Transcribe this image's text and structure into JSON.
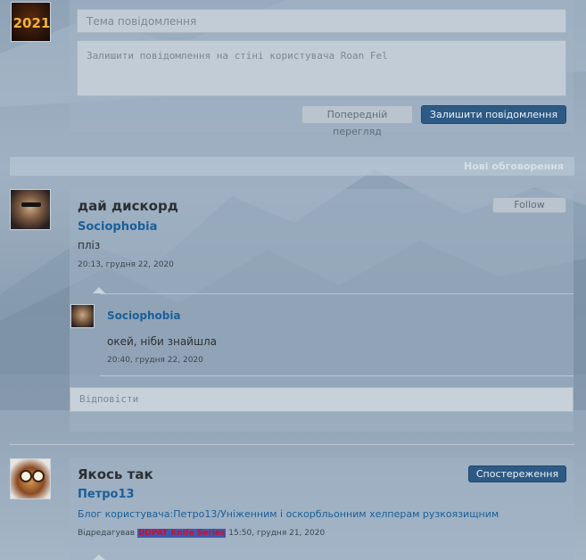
{
  "composer": {
    "subject_placeholder": "Тема повідомлення",
    "message_placeholder": "Залишити повідомлення на стіні користувача Roan Fel",
    "preview_label": "Попередній перегляд",
    "submit_label": "Залишити повідомлення",
    "avatar_caption": "2021"
  },
  "section": {
    "title": "Нові обговорення"
  },
  "thread1": {
    "title": "дай дискорд",
    "follow_label": "Follow",
    "author": "Sociophobia",
    "text": "пліз",
    "timestamp": "20:13, грудня 22, 2020",
    "reply": {
      "author": "Sociophobia",
      "text": "окей, ніби знайшла",
      "timestamp": "20:40, грудня 22, 2020"
    },
    "reply_placeholder": "Відповісти"
  },
  "thread2": {
    "title": "Якось так",
    "follow_label": "Спостереження",
    "author": "Петро13",
    "link": "Блог користувача:Петро13/Уніженним і оскорбльонним хелперам рузкоязищним",
    "edited_prefix": "Відредагував",
    "editor": "DDPAT Knife Series",
    "timestamp": "15:50, грудня 21, 2020"
  },
  "colors": {
    "accent": "#2d5a85",
    "link": "#1a5f99"
  }
}
